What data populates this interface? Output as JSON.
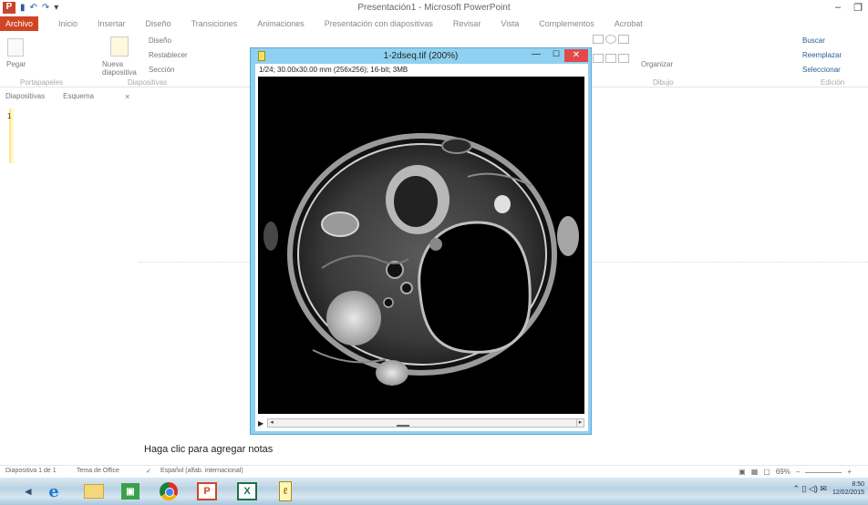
{
  "app": {
    "title": "Presentación1 - Microsoft PowerPoint",
    "logo": "P",
    "qat": {
      "save": "▮",
      "undo": "↶",
      "redo": "↷",
      "customize": "▾"
    },
    "window": {
      "minimize": "–",
      "restore": "❐"
    }
  },
  "ribbon_tabs": {
    "file": "Archivo",
    "items": [
      "Inicio",
      "Insertar",
      "Diseño",
      "Transiciones",
      "Animaciones",
      "Presentación con diapositivas",
      "Revisar",
      "Vista",
      "Complementos",
      "Acrobat"
    ]
  },
  "ribbon": {
    "paste": "Pegar",
    "new_slide": "Nueva diapositiva",
    "layout": "Diseño",
    "reset": "Restablecer",
    "section": "Sección",
    "group_clipboard": "Portapapeles",
    "group_slides": "Diapositivas",
    "arrange": "Organizar",
    "group_drawing": "Dibujo",
    "find": "Buscar",
    "replace": "Reemplazar",
    "select": "Seleccionar",
    "group_editing": "Edición"
  },
  "left_pane": {
    "tab_slides": "Diapositivas",
    "tab_outline": "Esquema",
    "close": "×",
    "slide_number": "1"
  },
  "notes": {
    "placeholder": "Haga clic para agregar notas"
  },
  "status": {
    "slide": "Diapositiva 1 de 1",
    "theme": "Tema de Office",
    "language": "Español (alfab. internacional)",
    "zoom": "69%",
    "zoom_minus": "–",
    "zoom_plus": "+"
  },
  "taskbar": {
    "tray_icons": "⌃ ▯ ◁) ✉",
    "time": "8:50",
    "date": "12/02/2015"
  },
  "imagej": {
    "title": "1-2dseq.tif (200%)",
    "info": "1/24; 30.00x30.00 mm (256x256); 16-bit; 3MB",
    "minimize": "—",
    "maximize": "☐",
    "close": "✕",
    "play": "▶",
    "arrow_left": "◂",
    "arrow_right": "▸",
    "slice_position": 0.42
  },
  "colors": {
    "file_tab": "#d04525",
    "imagej_frame": "#8fd1f0",
    "close_button": "#e2494a"
  }
}
